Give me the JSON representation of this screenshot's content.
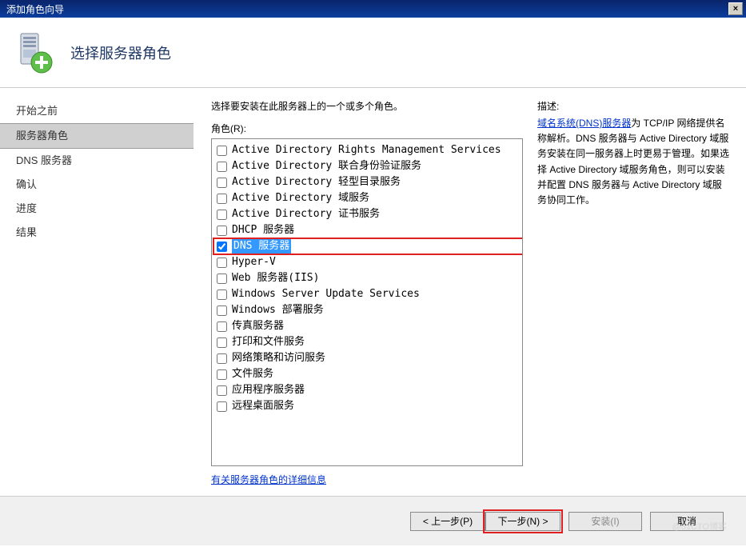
{
  "window": {
    "title": "添加角色向导",
    "close": "×"
  },
  "header": {
    "title": "选择服务器角色"
  },
  "sidebar": {
    "items": [
      {
        "label": "开始之前",
        "active": false
      },
      {
        "label": "服务器角色",
        "active": true
      },
      {
        "label": "DNS 服务器",
        "active": false
      },
      {
        "label": "确认",
        "active": false
      },
      {
        "label": "进度",
        "active": false
      },
      {
        "label": "结果",
        "active": false
      }
    ]
  },
  "main": {
    "instruction": "选择要安装在此服务器上的一个或多个角色。",
    "roles_label": "角色(R):",
    "roles": [
      {
        "label": "Active Directory Rights Management Services",
        "checked": false
      },
      {
        "label": "Active Directory 联合身份验证服务",
        "checked": false
      },
      {
        "label": "Active Directory 轻型目录服务",
        "checked": false
      },
      {
        "label": "Active Directory 域服务",
        "checked": false
      },
      {
        "label": "Active Directory 证书服务",
        "checked": false
      },
      {
        "label": "DHCP 服务器",
        "checked": false
      },
      {
        "label": "DNS 服务器",
        "checked": true,
        "highlighted": true
      },
      {
        "label": "Hyper-V",
        "checked": false
      },
      {
        "label": "Web 服务器(IIS)",
        "checked": false
      },
      {
        "label": "Windows Server Update Services",
        "checked": false
      },
      {
        "label": "Windows 部署服务",
        "checked": false
      },
      {
        "label": "传真服务器",
        "checked": false
      },
      {
        "label": "打印和文件服务",
        "checked": false
      },
      {
        "label": "网络策略和访问服务",
        "checked": false
      },
      {
        "label": "文件服务",
        "checked": false
      },
      {
        "label": "应用程序服务器",
        "checked": false
      },
      {
        "label": "远程桌面服务",
        "checked": false
      }
    ],
    "more_info": "有关服务器角色的详细信息"
  },
  "description": {
    "label": "描述:",
    "link_text": "域名系统(DNS)服务器",
    "body": "为 TCP/IP 网络提供名称解析。DNS 服务器与 Active Directory 域服务安装在同一服务器上时更易于管理。如果选择 Active Directory 域服务角色，则可以安装并配置 DNS 服务器与 Active Directory 域服务协同工作。"
  },
  "buttons": {
    "prev": "< 上一步(P)",
    "next": "下一步(N) >",
    "install": "安装(I)",
    "cancel": "取消"
  },
  "watermark": "@51CTO博客"
}
